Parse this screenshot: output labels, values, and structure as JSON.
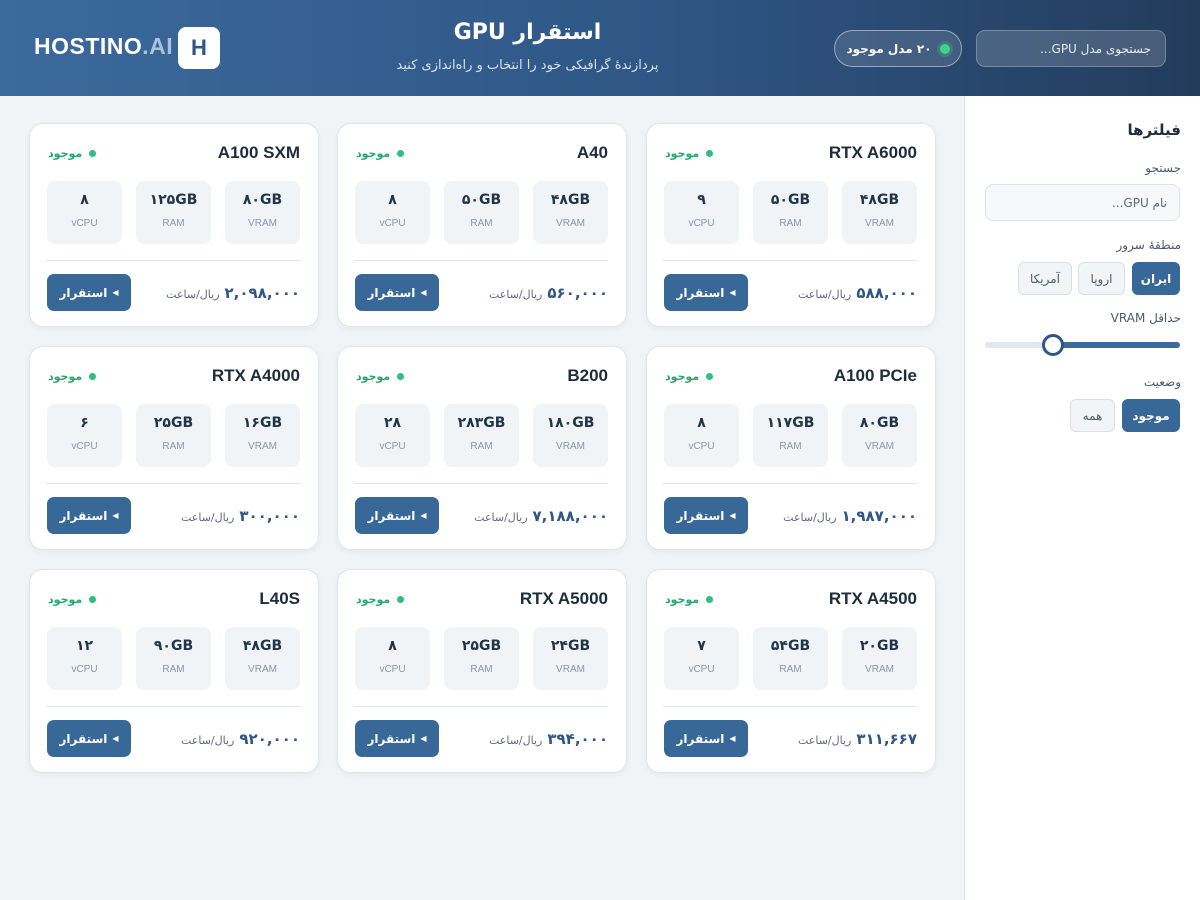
{
  "header": {
    "search_placeholder": "جستجوی مدل GPU...",
    "available_count": "۲۰ مدل موجود",
    "title": "استقرار GPU",
    "subtitle": "پردازندهٔ گرافیکی خود را انتخاب و راه‌اندازی کنید",
    "logo_letter": "H",
    "brand_main": "HOSTINO",
    "brand_suffix": ".AI"
  },
  "sidebar": {
    "title": "فیلترها",
    "search_label": "جستجو",
    "search_placeholder": "نام GPU...",
    "region_label": "منطقهٔ سرور",
    "regions": [
      "ایران",
      "اروپا",
      "آمریکا"
    ],
    "region_selected": "ایران",
    "vram_label": "حداقل VRAM",
    "vram_slider_fraction": 0.35,
    "status_label": "وضعیت",
    "statuses": [
      "موجود",
      "همه"
    ],
    "status_selected": "موجود"
  },
  "card_labels": {
    "status": "موجود",
    "vram": "VRAM",
    "ram": "RAM",
    "vcpu": "vCPU",
    "price_unit": "ریال/ساعت",
    "deploy": "استقرار",
    "play_icon": "play-icon"
  },
  "cards": [
    {
      "name": "RTX A6000",
      "vram": "۴۸GB",
      "ram": "۵۰GB",
      "vcpu": "۹",
      "price": "۵۸۸,۰۰۰"
    },
    {
      "name": "A40",
      "vram": "۴۸GB",
      "ram": "۵۰GB",
      "vcpu": "۸",
      "price": "۵۶۰,۰۰۰"
    },
    {
      "name": "A100 SXM",
      "vram": "۸۰GB",
      "ram": "۱۲۵GB",
      "vcpu": "۸",
      "price": "۲,۰۹۸,۰۰۰"
    },
    {
      "name": "A100 PCIe",
      "vram": "۸۰GB",
      "ram": "۱۱۷GB",
      "vcpu": "۸",
      "price": "۱,۹۸۷,۰۰۰"
    },
    {
      "name": "B200",
      "vram": "۱۸۰GB",
      "ram": "۲۸۳GB",
      "vcpu": "۲۸",
      "price": "۷,۱۸۸,۰۰۰"
    },
    {
      "name": "RTX A4000",
      "vram": "۱۶GB",
      "ram": "۲۵GB",
      "vcpu": "۶",
      "price": "۳۰۰,۰۰۰"
    },
    {
      "name": "RTX A4500",
      "vram": "۲۰GB",
      "ram": "۵۴GB",
      "vcpu": "۷",
      "price": "۳۱۱,۶۶۷"
    },
    {
      "name": "RTX A5000",
      "vram": "۲۴GB",
      "ram": "۲۵GB",
      "vcpu": "۸",
      "price": "۳۹۴,۰۰۰"
    },
    {
      "name": "L40S",
      "vram": "۴۸GB",
      "ram": "۹۰GB",
      "vcpu": "۱۲",
      "price": "۹۲۰,۰۰۰"
    }
  ]
}
